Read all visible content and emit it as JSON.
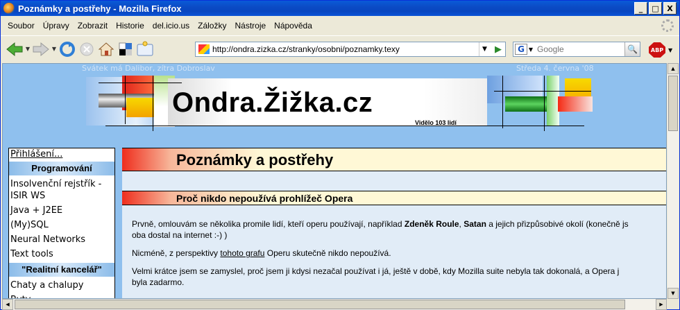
{
  "window": {
    "title": "Poznámky a postřehy - Mozilla Firefox",
    "controls": {
      "minimize": "_",
      "maximize": "□",
      "close": "X"
    }
  },
  "menu": [
    "Soubor",
    "Úpravy",
    "Zobrazit",
    "Historie",
    "del.icio.us",
    "Záložky",
    "Nástroje",
    "Nápověda"
  ],
  "toolbar": {
    "back_icon": "back-arrow-icon",
    "forward_icon": "forward-arrow-icon",
    "reload_icon": "reload-icon",
    "stop_icon": "stop-icon",
    "home_icon": "home-icon",
    "tag_label": "TAG"
  },
  "address": {
    "url": "http://ondra.zizka.cz/stranky/osobni/poznamky.texy"
  },
  "search": {
    "engine": "G",
    "placeholder": "Google"
  },
  "adblock": {
    "label": "ABP"
  },
  "page": {
    "nameday": "Svátek má Dalibor, zítra Dobroslav",
    "date": "Středa 4. června '08",
    "site_title": "Ondra.Žižka.cz",
    "visits": "Vidělo 103 lidí",
    "sidebar": {
      "login": "Přihlášení...",
      "sections": [
        {
          "title": "Programování",
          "items": [
            "Insolvenční rejstřík - ISIR WS",
            "Java + J2EE",
            "(My)SQL",
            "Neural Networks",
            "Text tools"
          ]
        },
        {
          "title": "\"Realitní kancelář\"",
          "items": [
            "Chaty a chalupy",
            "Byty"
          ]
        }
      ]
    },
    "h1": "Poznámky a postřehy",
    "h2": "Proč nikdo nepoužívá prohlížeč Opera",
    "p1": {
      "a": "Prvně, omlouvám se několika promile lidí, kteří operu používají, například ",
      "b1": "Zdeněk Roule",
      "c": ", ",
      "b2": "Satan",
      "d": " a jejich přizpůsobivé okolí (konečně js",
      "e": "oba dostal na internet :-) )"
    },
    "p2": {
      "a": "Nicméně, z perspektivy ",
      "link": "tohoto grafu",
      "b": " Operu skutečně nikdo nepoužívá."
    },
    "p3": {
      "a": "Velmi krátce jsem se zamyslel, proč jsem ji kdysi nezačal používat i já, ještě v době, kdy Mozilla suite nebyla tak dokonalá, a Opera j",
      "b": "byla zadarmo."
    }
  }
}
